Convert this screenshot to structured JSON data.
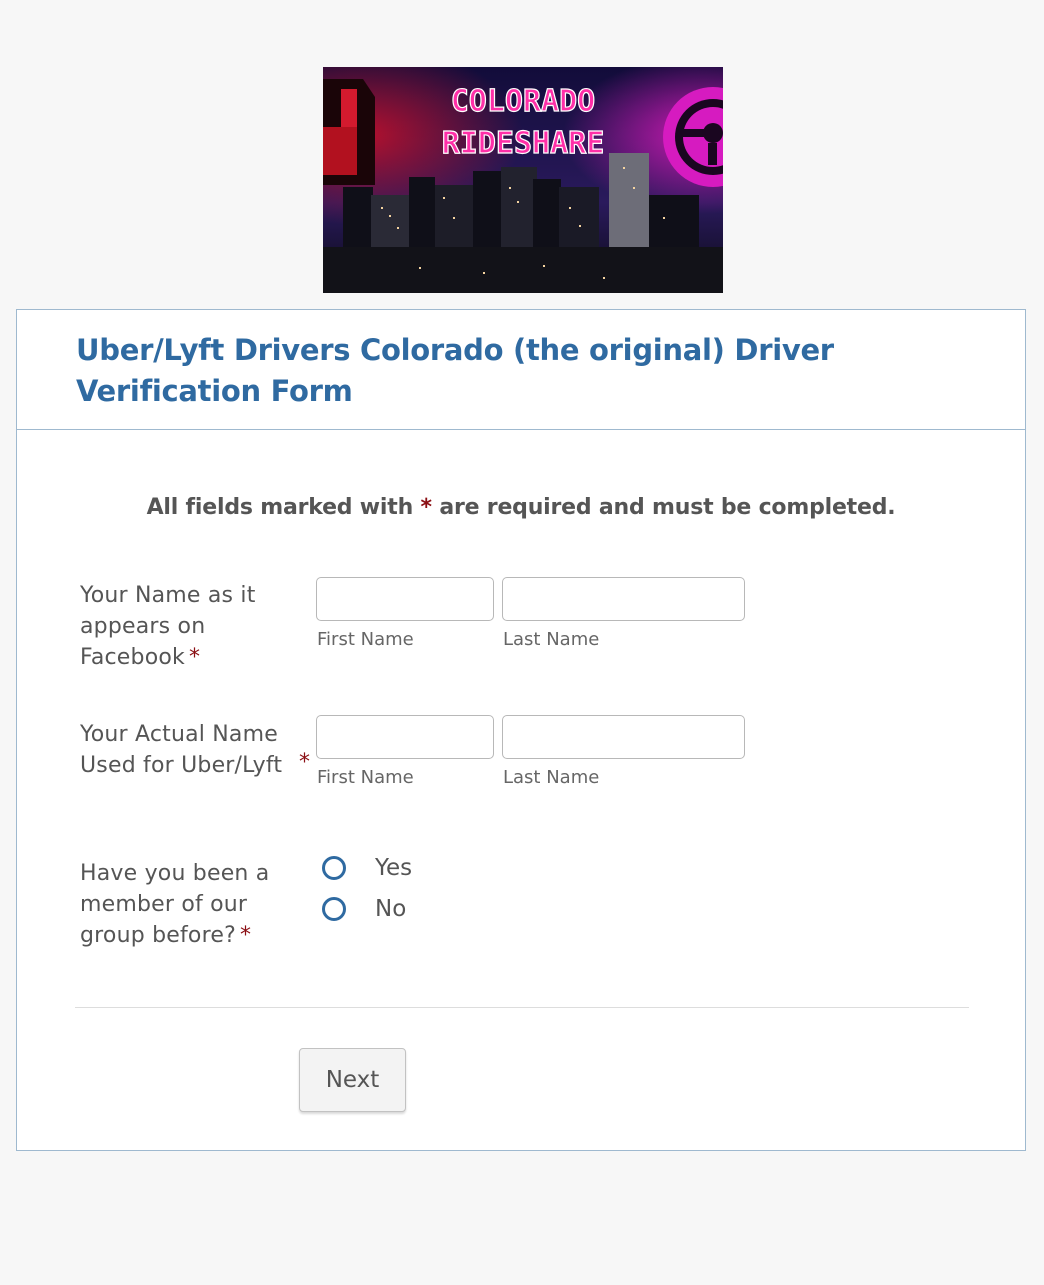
{
  "banner": {
    "line1": "COLORADO",
    "line2": "RIDESHARE"
  },
  "form": {
    "title": "Uber/Lyft Drivers Colorado (the original) Driver Verification Form",
    "required_note_before": "All fields marked with",
    "required_star": "*",
    "required_note_after": "are required and must be completed.",
    "fields": [
      {
        "label": "Your Name as it appears on Facebook",
        "first_sublabel": "First Name",
        "last_sublabel": "Last Name",
        "first_value": "",
        "last_value": ""
      },
      {
        "label": "Your Actual Name Used for Uber/Lyft",
        "first_sublabel": "First Name",
        "last_sublabel": "Last Name",
        "first_value": "",
        "last_value": ""
      }
    ],
    "member_question": {
      "label": "Have you been a member of our group before?",
      "options": [
        "Yes",
        "No"
      ]
    },
    "next_label": "Next"
  },
  "colors": {
    "accent": "#2f6aa1",
    "required": "#8b0f14",
    "border": "#9fb9cf",
    "background": "#f7f7f7"
  }
}
